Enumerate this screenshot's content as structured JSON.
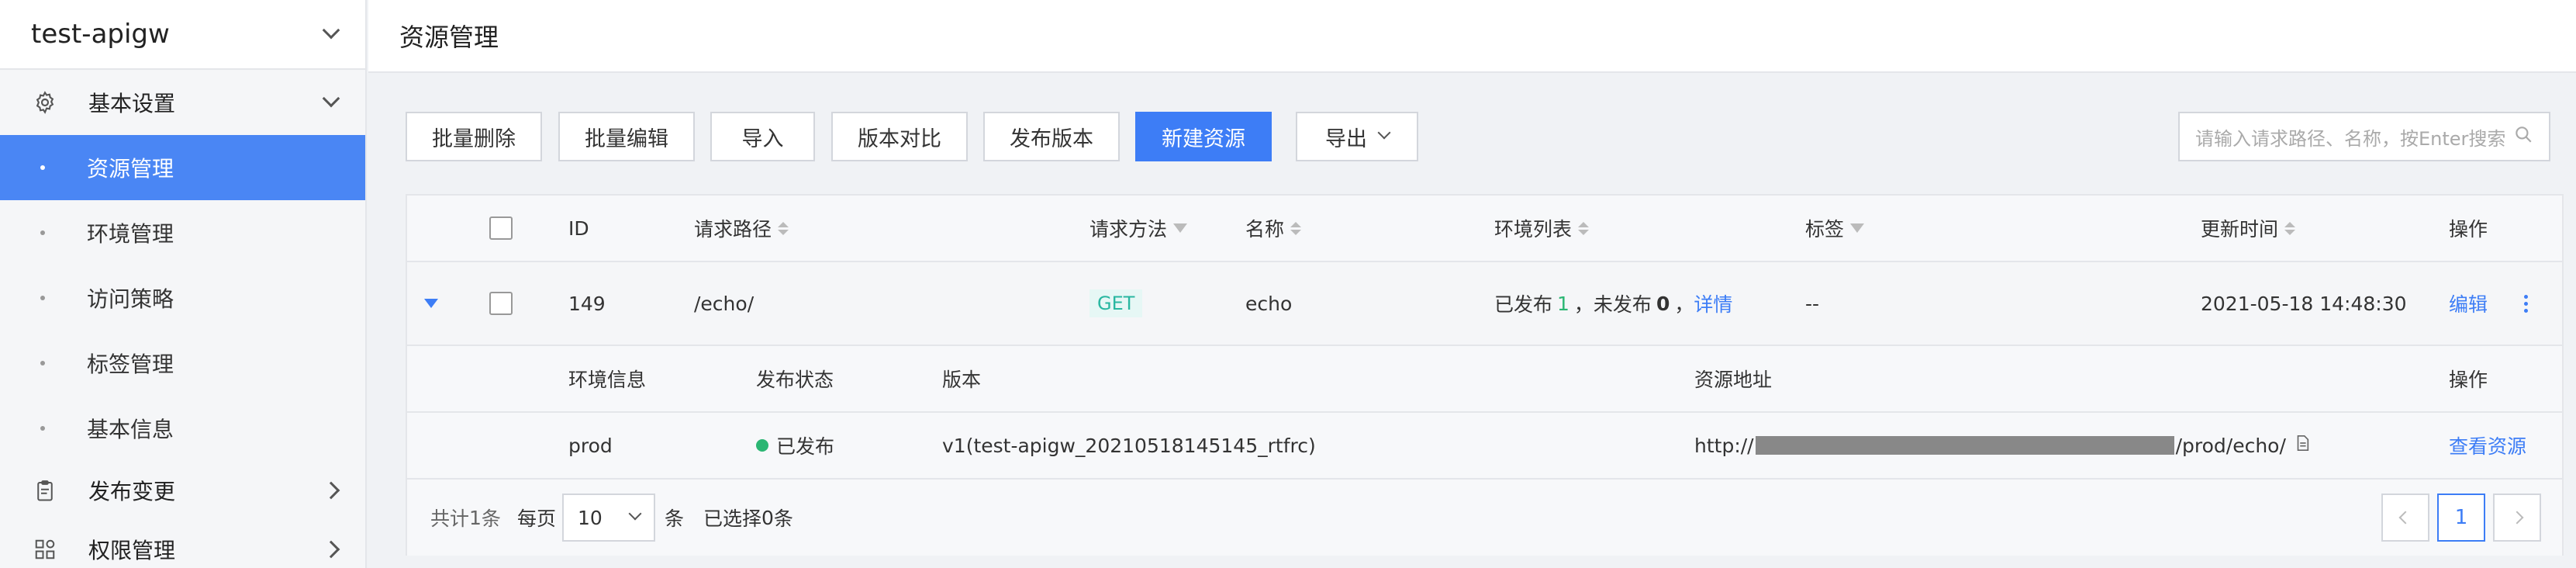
{
  "sidebar": {
    "title": "test-apigw",
    "groups": [
      {
        "label": "基本设置",
        "icon": "gear-icon"
      },
      {
        "label": "发布变更",
        "icon": "clipboard-icon"
      },
      {
        "label": "权限管理",
        "icon": "grid-icon"
      }
    ],
    "items": [
      {
        "label": "资源管理",
        "active": true
      },
      {
        "label": "环境管理"
      },
      {
        "label": "访问策略"
      },
      {
        "label": "标签管理"
      },
      {
        "label": "基本信息"
      }
    ]
  },
  "header": {
    "title": "资源管理"
  },
  "toolbar": {
    "batch_delete": "批量删除",
    "batch_edit": "批量编辑",
    "import": "导入",
    "version_compare": "版本对比",
    "publish_version": "发布版本",
    "new_resource": "新建资源",
    "export": "导出",
    "search_placeholder": "请输入请求路径、名称，按Enter搜索"
  },
  "table": {
    "columns": [
      "ID",
      "请求路径",
      "请求方法",
      "名称",
      "环境列表",
      "标签",
      "更新时间",
      "操作"
    ],
    "rows": [
      {
        "id": "149",
        "path": "/echo/",
        "method": "GET",
        "name": "echo",
        "env_published_label": "已发布",
        "env_published_count": "1",
        "env_unpublished_label": "，未发布",
        "env_unpublished_count": "0",
        "env_detail_sep": "，",
        "env_detail": "详情",
        "tags": "--",
        "updated": "2021-05-18 14:48:30",
        "action": "编辑"
      }
    ],
    "sub_columns": [
      "环境信息",
      "发布状态",
      "版本",
      "资源地址",
      "操作"
    ],
    "sub_rows": [
      {
        "env": "prod",
        "status": "已发布",
        "version": "v1(test-apigw_20210518145145_rtfrc)",
        "url_prefix": "http://",
        "url_suffix": "/prod/echo/",
        "action": "查看资源"
      }
    ]
  },
  "footer": {
    "total_prefix": "共计",
    "total": "1",
    "total_suffix": "条",
    "per_page_label": "每页",
    "per_page": "10",
    "per_page_suffix": "条",
    "selected_prefix": "已选择",
    "selected": "0",
    "selected_suffix": "条",
    "current_page": "1"
  },
  "colors": {
    "accent": "#3d7df6",
    "success": "#2bb673",
    "sidebar_active": "#4a86f4"
  }
}
